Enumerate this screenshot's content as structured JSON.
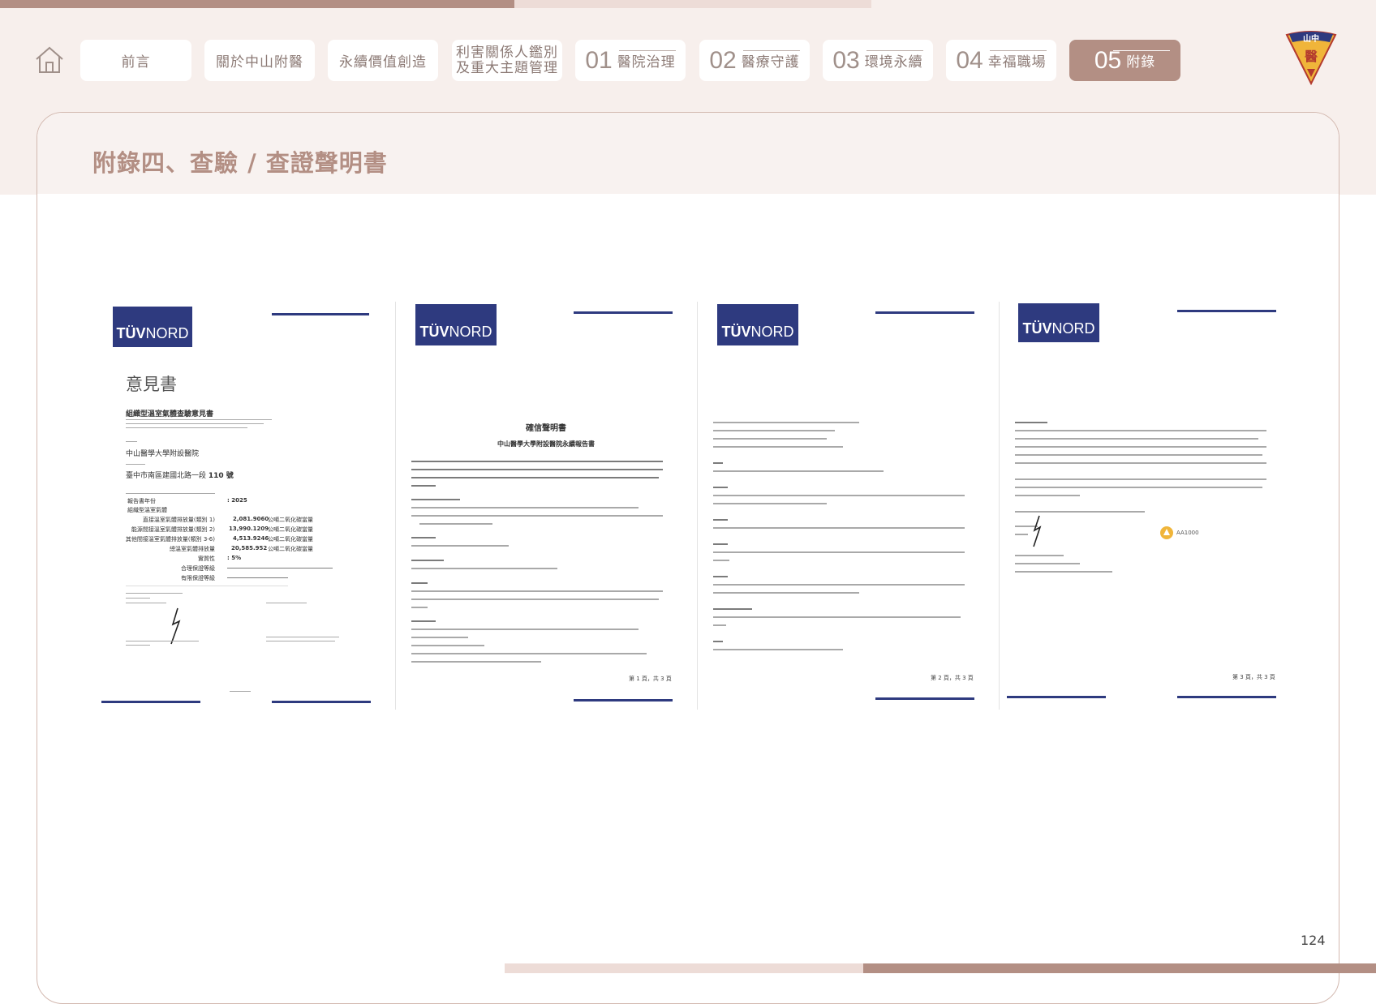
{
  "nav": {
    "items": [
      {
        "label": "前言"
      },
      {
        "label": "關於中山附醫"
      },
      {
        "label": "永續價值創造"
      },
      {
        "line1": "利害關係人鑑別",
        "line2": "及重大主題管理"
      },
      {
        "num": "01",
        "label": "醫院治理"
      },
      {
        "num": "02",
        "label": "醫療守護"
      },
      {
        "num": "03",
        "label": "環境永續"
      },
      {
        "num": "04",
        "label": "幸福職場"
      },
      {
        "num": "05",
        "label": "附錄",
        "active": true
      }
    ],
    "logo_text": "山中",
    "logo_char": "醫"
  },
  "section_title": "附錄四、查驗 / 查證聲明書",
  "documents": [
    {
      "badge_a": "TÜV",
      "badge_b": "NORD",
      "heading": "意見書",
      "subheading": "組織型溫室氣體查驗意見書",
      "hospital": "中山醫學大學附設醫院",
      "address": "臺中市南區建國北路一段",
      "address_num": "110 號",
      "year_label": "報告書年份",
      "year_value": ": 2025",
      "scope_label": "組織型溫室氣體",
      "rows": [
        {
          "label": "直接溫室氣體排放量(類別 1)",
          "value": "2,081.9060",
          "unit": "公噸二氧化碳當量"
        },
        {
          "label": "能源間接溫室氣體排放量(類別 2)",
          "value": "13,990.1209",
          "unit": "公噸二氧化碳當量"
        },
        {
          "label": "其他間接溫室氣體排放量(類別 3-6)",
          "value": "4,513.9246",
          "unit": "公噸二氧化碳當量"
        },
        {
          "label": "總溫室氣體排放量",
          "value": "20,585.952",
          "unit": "公噸二氧化碳當量"
        },
        {
          "label": "實質性",
          "value": ": 5%",
          "unit": ""
        },
        {
          "label": "合理保證等級",
          "value": "",
          "unit": ""
        },
        {
          "label": "有限保證等級",
          "value": "",
          "unit": ""
        }
      ]
    },
    {
      "badge_a": "TÜV",
      "badge_b": "NORD",
      "title": "確信聲明書",
      "subtitle": "中山醫學大學附設醫院永續報告書",
      "page_foot": "第 1 頁，共 3 頁"
    },
    {
      "badge_a": "TÜV",
      "badge_b": "NORD",
      "page_foot": "第 2 頁，共 3 頁"
    },
    {
      "badge_a": "TÜV",
      "badge_b": "NORD",
      "stamp": "AA1000",
      "page_foot": "第 3 頁，共 3 頁"
    }
  ],
  "page_number": "124",
  "colors": {
    "accent": "#b38f84",
    "band": "#f7efec",
    "tuv_blue": "#2e3a7f"
  }
}
